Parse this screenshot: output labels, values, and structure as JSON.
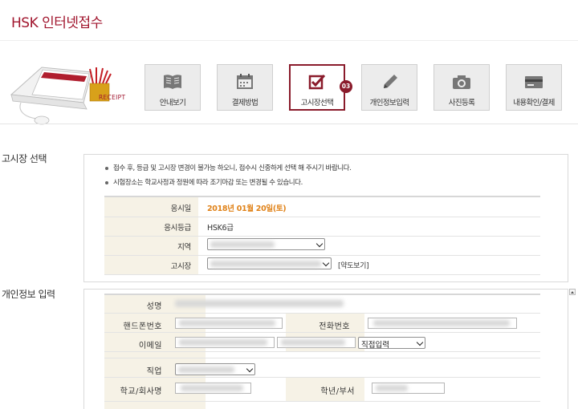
{
  "page_title": "HSK 인터넷접수",
  "receipt_text": "RECEIPT",
  "steps": [
    {
      "label": "안내보기",
      "icon": "book-icon"
    },
    {
      "label": "결제방법",
      "icon": "calendar-icon"
    },
    {
      "label": "고시장선택",
      "icon": "checkbox-icon",
      "active": true,
      "badge": "03"
    },
    {
      "label": "개인정보입력",
      "icon": "pencil-icon"
    },
    {
      "label": "사진등록",
      "icon": "camera-icon"
    },
    {
      "label": "내용확인/결제",
      "icon": "card-icon"
    }
  ],
  "section1": {
    "title": "고시장 선택",
    "notices": [
      "접수 후, 등급 및 고시장 변경이 불가능 하오니, 접수시 신중하게 선택 해 주시기 바랍니다.",
      "시험장소는 학교사정과 정원에 따라 조기마감 또는 변경될 수 있습니다."
    ],
    "rows": {
      "exam_date_label": "응시일",
      "exam_date_value": "2018년 01월 20일(토)",
      "exam_level_label": "응시등급",
      "exam_level_value": "HSK6급",
      "region_label": "지역",
      "site_label": "고시장",
      "map_button": "[약도보기]"
    }
  },
  "section2": {
    "title": "개인정보 입력",
    "name_label": "성명",
    "mobile_label": "핸드폰번호",
    "phone_label": "전화번호",
    "email_label": "이메일",
    "email_domain_select": "직접입력",
    "job_label": "직업",
    "school_label": "학교/회사명",
    "grade_label": "학년/부서"
  },
  "colors": {
    "brand": "#a1162e",
    "active_border": "#8a1b2b",
    "label_bg": "#f6f2e6",
    "date_accent": "#e08218"
  }
}
